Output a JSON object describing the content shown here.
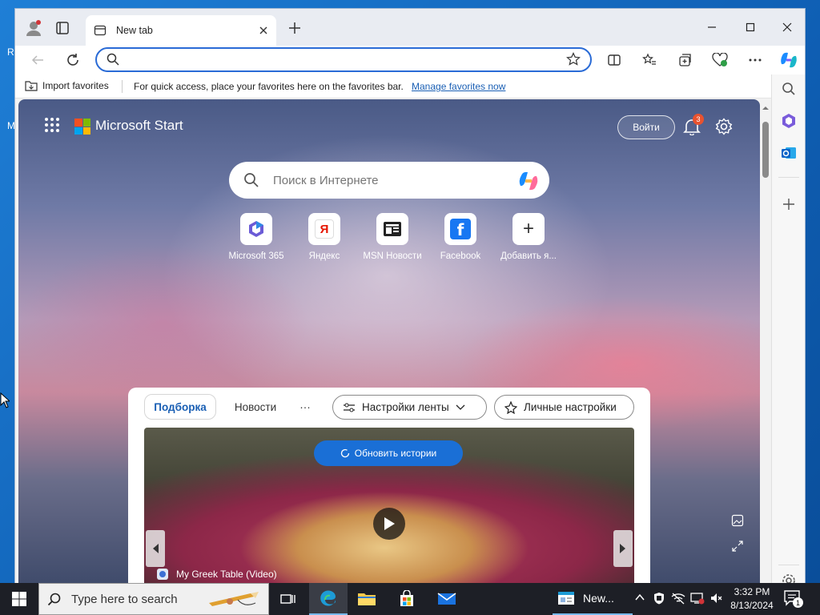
{
  "desktop": {
    "letters": [
      "R",
      "M"
    ]
  },
  "browser": {
    "tab_title": "New tab",
    "address": {
      "value": "",
      "placeholder": ""
    },
    "favorites_bar": {
      "import_label": "Import favorites",
      "message": "For quick access, place your favorites here on the favorites bar.",
      "manage_link": "Manage favorites now"
    }
  },
  "start_page": {
    "brand": "Microsoft Start",
    "signin_label": "Войти",
    "notification_count": "3",
    "search_placeholder": "Поиск в Интернете",
    "quick_links": [
      {
        "label": "Microsoft 365",
        "icon": "m365-icon"
      },
      {
        "label": "Яндекс",
        "icon": "yandex-icon",
        "glyph": "Я"
      },
      {
        "label": "MSN Новости",
        "icon": "msn-news-icon"
      },
      {
        "label": "Facebook",
        "icon": "facebook-icon",
        "glyph": "f"
      },
      {
        "label": "Добавить я...",
        "icon": "add-icon",
        "glyph": "+"
      }
    ],
    "feed": {
      "tabs": {
        "featured": "Подборка",
        "news": "Новости",
        "more": "···"
      },
      "feed_settings": "Настройки ленты",
      "personal_settings": "Личные настройки",
      "refresh_button": "Обновить истории",
      "hero_caption": "My Greek Table (Video)"
    }
  },
  "taskbar": {
    "search_placeholder": "Type here to search",
    "edge_window_label": "New...",
    "time": "3:32 PM",
    "date": "8/13/2024",
    "notification_count": "1"
  },
  "colors": {
    "accent": "#1a6fd6",
    "ms_red": "#f25022",
    "ms_green": "#7fba00",
    "ms_blue": "#00a4ef",
    "ms_yellow": "#ffb900"
  }
}
